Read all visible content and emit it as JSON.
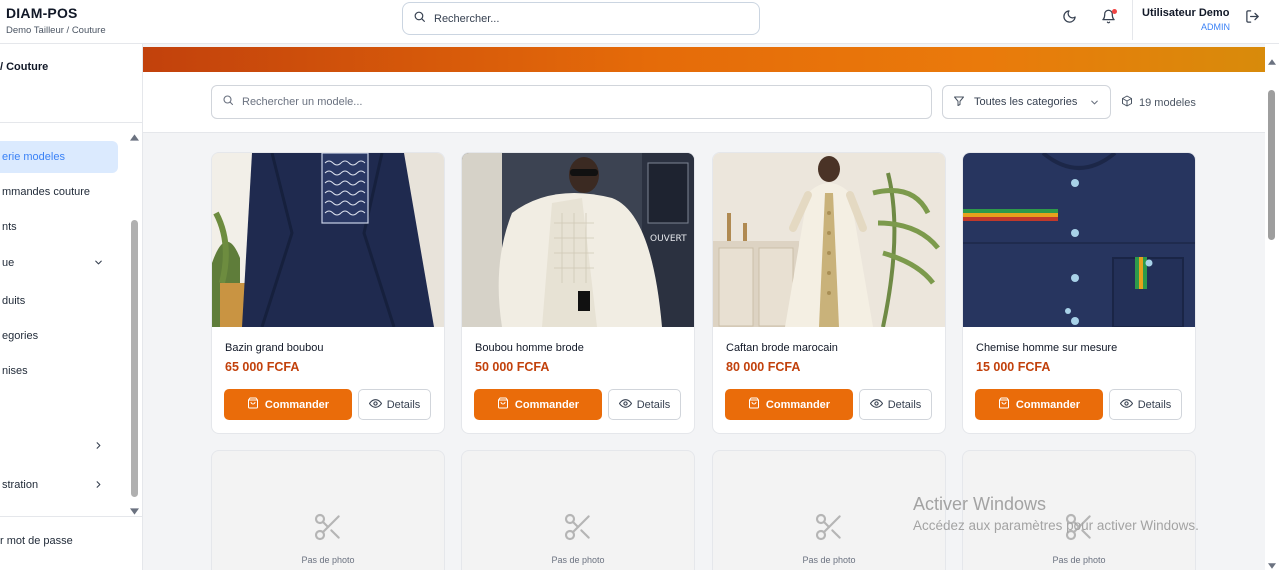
{
  "header": {
    "app_title": "DIAM-POS",
    "app_subtitle": "Demo Tailleur / Couture",
    "search_placeholder": "Rechercher...",
    "user_name": "Utilisateur Demo",
    "user_role": "ADMIN",
    "icons": [
      "search-icon",
      "moon-icon",
      "bell-icon",
      "logout-icon"
    ]
  },
  "sidebar": {
    "heading": "/ Couture",
    "items": [
      {
        "label": "erie modeles",
        "active": true
      },
      {
        "label": "mmandes couture"
      },
      {
        "label": "nts"
      },
      {
        "label": "ue",
        "chevron": "down"
      },
      {
        "label": "duits"
      },
      {
        "label": "egories"
      },
      {
        "label": "nises"
      },
      {
        "label": "",
        "chevron": "right"
      },
      {
        "label": "stration",
        "chevron": "right"
      }
    ],
    "footer_label": "r mot de passe"
  },
  "toolbar": {
    "search_placeholder": "Rechercher un modele...",
    "category_label": "Toutes les categories",
    "model_count": "19 modeles"
  },
  "models": [
    {
      "name": "Bazin grand boubou",
      "price": "65 000 FCFA",
      "order_label": "Commander",
      "details_label": "Details"
    },
    {
      "name": "Boubou homme brode",
      "price": "50 000 FCFA",
      "order_label": "Commander",
      "details_label": "Details"
    },
    {
      "name": "Caftan brode marocain",
      "price": "80 000 FCFA",
      "order_label": "Commander",
      "details_label": "Details"
    },
    {
      "name": "Chemise homme sur mesure",
      "price": "15 000 FCFA",
      "order_label": "Commander",
      "details_label": "Details"
    }
  ],
  "placeholders": [
    {
      "label": "Pas de photo"
    },
    {
      "label": "Pas de photo"
    },
    {
      "label": "Pas de photo"
    },
    {
      "label": "Pas de photo"
    }
  ],
  "watermark": {
    "line1": "Activer Windows",
    "line2": "Accédez aux paramètres pour activer Windows."
  },
  "colors": {
    "accent": "#ea6c0a",
    "price": "#c2410c",
    "active_nav_bg": "#dbeafe",
    "active_nav_text": "#3b82f6"
  }
}
